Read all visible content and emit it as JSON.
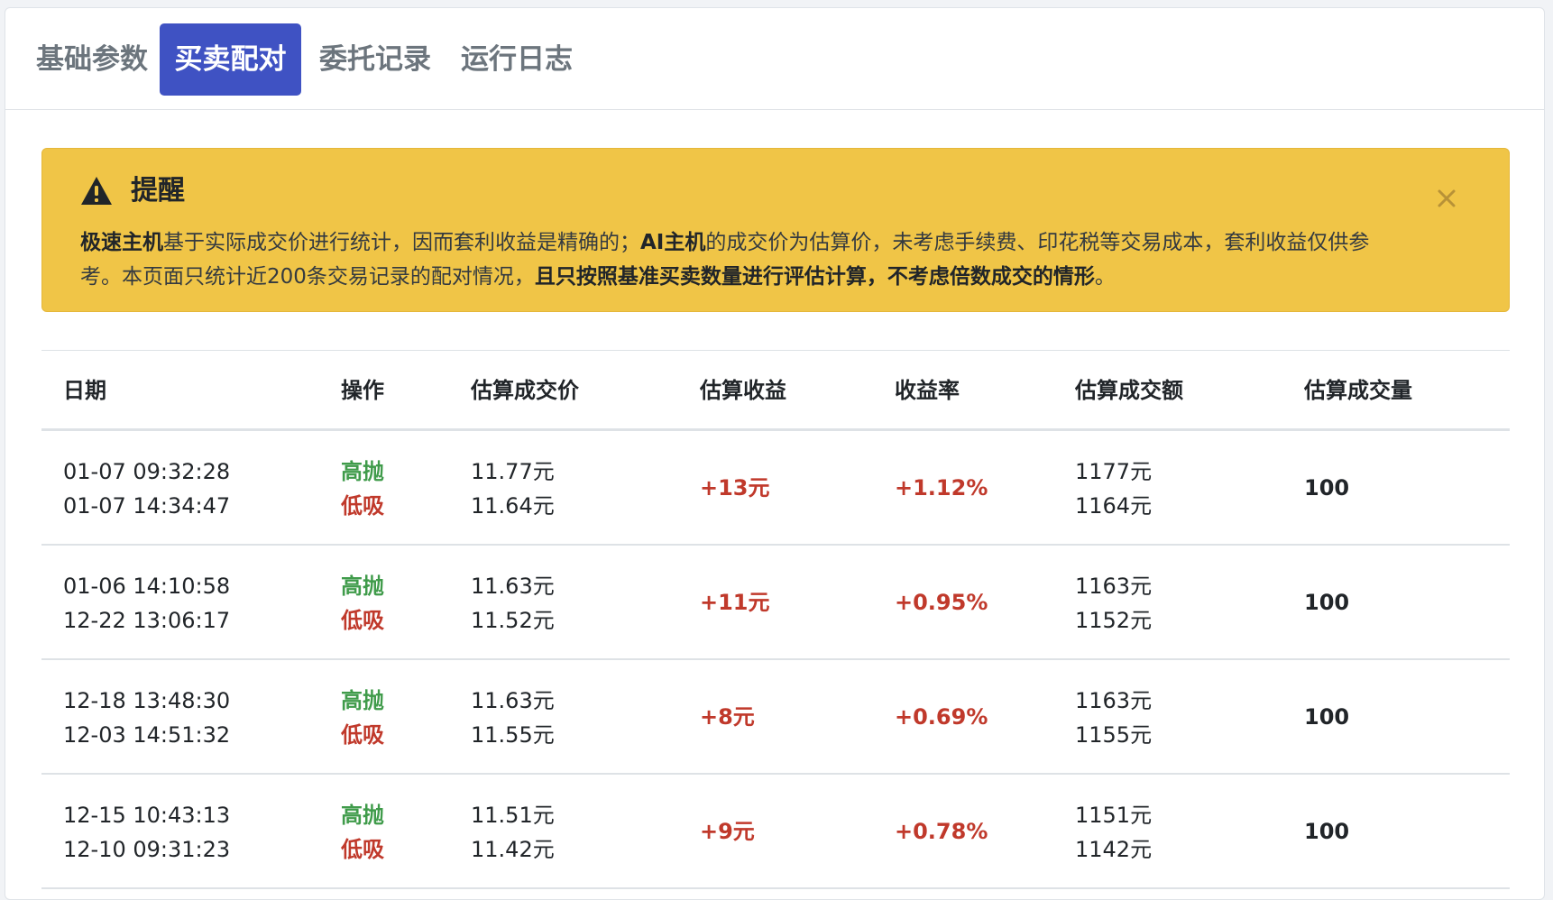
{
  "tabs": [
    {
      "label": "基础参数"
    },
    {
      "label": "买卖配对"
    },
    {
      "label": "委托记录"
    },
    {
      "label": "运行日志"
    }
  ],
  "active_tab": "买卖配对",
  "alert": {
    "title": "提醒",
    "seg1_bold": "极速主机",
    "seg2": "基于实际成交价进行统计，因而套利收益是精确的；",
    "seg3_bold": "AI主机",
    "seg4": "的成交价为估算价，未考虑手续费、印花税等交易成本，套利收益仅供参考。本页面只统计近200条交易记录的配对情况，",
    "seg5_bold": "且只按照基准买卖数量进行评估计算，不考虑倍数成交的情形",
    "seg6": "。",
    "icon": "warning-triangle-icon",
    "close_icon": "close-icon",
    "background": "#f0c547"
  },
  "table": {
    "headers": {
      "date": "日期",
      "op": "操作",
      "price": "估算成交价",
      "profit": "估算收益",
      "rate": "收益率",
      "amount": "估算成交额",
      "qty": "估算成交量"
    },
    "rows": [
      {
        "date1": "01-07 09:32:28",
        "date2": "01-07 14:34:47",
        "op1": "高抛",
        "op2": "低吸",
        "price1": "11.77元",
        "price2": "11.64元",
        "profit": "+13元",
        "rate": "+1.12%",
        "amount1": "1177元",
        "amount2": "1164元",
        "qty": "100"
      },
      {
        "date1": "01-06 14:10:58",
        "date2": "12-22 13:06:17",
        "op1": "高抛",
        "op2": "低吸",
        "price1": "11.63元",
        "price2": "11.52元",
        "profit": "+11元",
        "rate": "+0.95%",
        "amount1": "1163元",
        "amount2": "1152元",
        "qty": "100"
      },
      {
        "date1": "12-18 13:48:30",
        "date2": "12-03 14:51:32",
        "op1": "高抛",
        "op2": "低吸",
        "price1": "11.63元",
        "price2": "11.55元",
        "profit": "+8元",
        "rate": "+0.69%",
        "amount1": "1163元",
        "amount2": "1155元",
        "qty": "100"
      },
      {
        "date1": "12-15 10:43:13",
        "date2": "12-10 09:31:23",
        "op1": "高抛",
        "op2": "低吸",
        "price1": "11.51元",
        "price2": "11.42元",
        "profit": "+9元",
        "rate": "+0.78%",
        "amount1": "1151元",
        "amount2": "1142元",
        "qty": "100"
      }
    ]
  },
  "colors": {
    "accent": "#3f52c3",
    "sell": "#3f9b4a",
    "buy_and_profit": "#c0392b"
  }
}
